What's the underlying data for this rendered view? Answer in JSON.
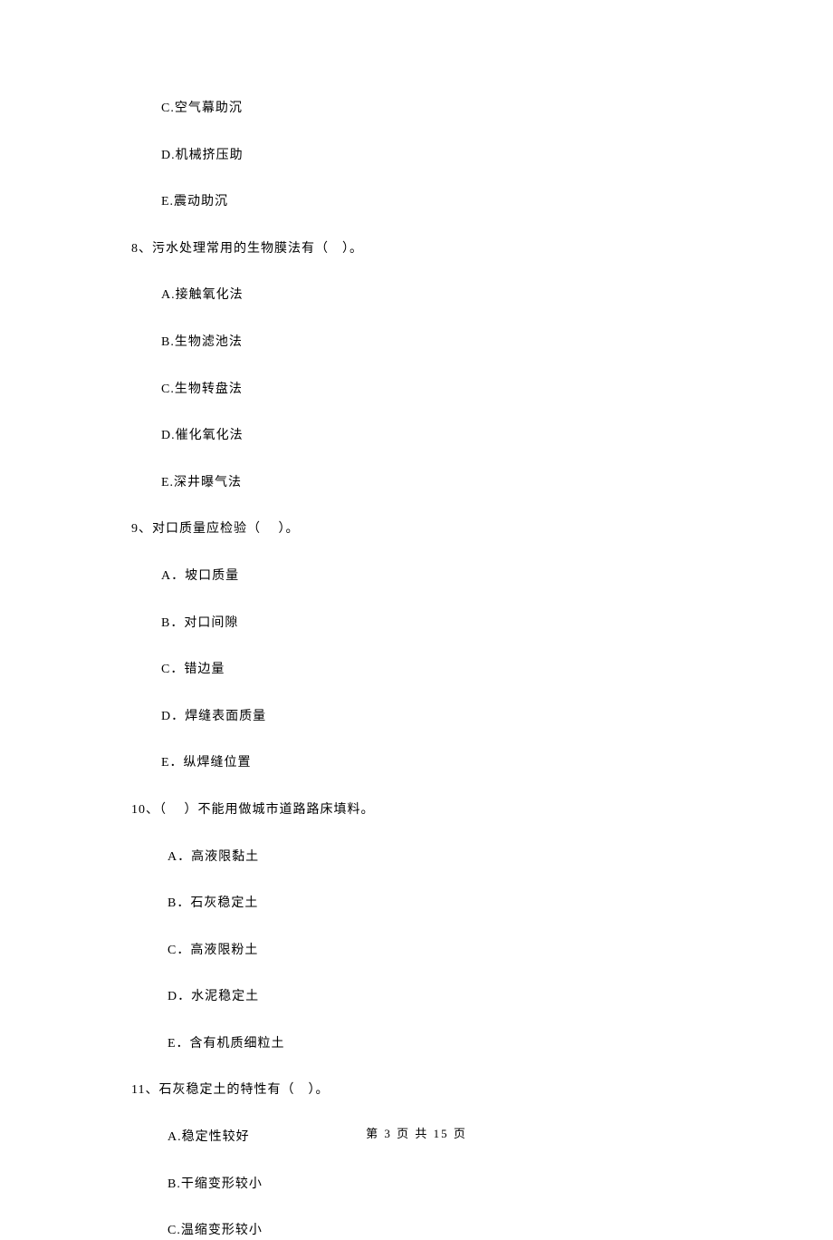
{
  "options_pre": [
    "C.空气幕助沉",
    "D.机械挤压助",
    "E.震动助沉"
  ],
  "q8": {
    "stem": "8、污水处理常用的生物膜法有（　）。",
    "options": [
      "A.接触氧化法",
      "B.生物滤池法",
      "C.生物转盘法",
      "D.催化氧化法",
      "E.深井曝气法"
    ]
  },
  "q9": {
    "stem": "9、对口质量应检验（　 ）。",
    "options": [
      "A．坡口质量",
      "B．对口间隙",
      "C．错边量",
      "D．焊缝表面质量",
      "E．纵焊缝位置"
    ]
  },
  "q10": {
    "stem": "10、（　 ）不能用做城市道路路床填料。",
    "options": [
      "A．高液限黏土",
      "B．石灰稳定土",
      "C．高液限粉土",
      "D．水泥稳定土",
      "E．含有机质细粒土"
    ]
  },
  "q11": {
    "stem": "11、石灰稳定土的特性有（　）。",
    "options": [
      "A.稳定性较好",
      "B.干缩变形较小",
      "C.温缩变形较小"
    ]
  },
  "footer": "第 3 页 共 15 页"
}
